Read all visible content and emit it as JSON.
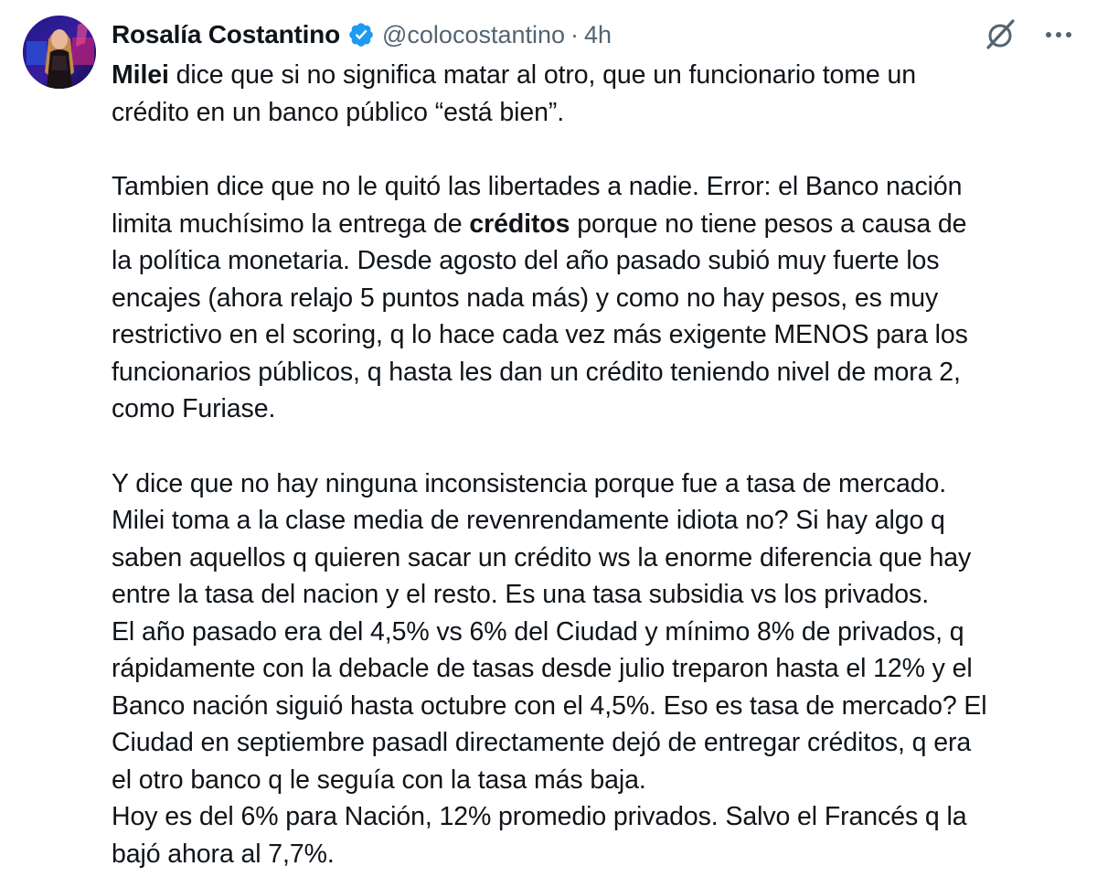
{
  "author": {
    "name": "Rosalía Costantino",
    "handle": "@colocostantino",
    "separator": "·",
    "time": "4h"
  },
  "colors": {
    "text": "#0f1419",
    "secondary": "#536471",
    "verified": "#1d9bf0"
  },
  "icons": {
    "verified": "verified-badge-icon",
    "grok": "grok-icon",
    "more": "more-horizontal-icon"
  },
  "tweet": {
    "p1": {
      "bold": "Milei",
      "l1_rest": " dice que si no significa matar al otro, que un funcionario tome un",
      "l2": "crédito en un banco público “está bien”."
    },
    "p2": {
      "l1": "Tambien dice que no le quitó las libertades a nadie. Error: el Banco nación",
      "l2_pre": "limita muchísimo la entrega de ",
      "l2_bold": "créditos",
      "l2_post": " porque no tiene pesos a causa de",
      "l3": "la política monetaria. Desde agosto del año pasado subió muy fuerte los",
      "l4": "encajes (ahora relajo 5 puntos nada más) y como no hay pesos, es muy",
      "l5": "restrictivo en el scoring, q lo hace cada vez más exigente MENOS para los",
      "l6": "funcionarios públicos, q hasta les dan un crédito teniendo nivel de mora 2,",
      "l7": "como Furiase."
    },
    "p3": {
      "l1": "Y dice que no hay ninguna inconsistencia porque fue a tasa de mercado.",
      "l2": "Milei toma a la clase media de revenrendamente idiota no? Si hay algo q",
      "l3": "saben aquellos q quieren sacar un crédito ws la enorme diferencia que hay",
      "l4": "entre la tasa del nacion y el resto. Es una tasa subsidia vs los privados.",
      "l5": "El año pasado era del 4,5% vs 6% del Ciudad y mínimo 8% de privados, q",
      "l6": "rápidamente con la debacle de tasas desde julio treparon hasta el 12% y el",
      "l7": "Banco nación siguió hasta octubre con el 4,5%. Eso es tasa de mercado? El",
      "l8": "Ciudad en septiembre pasadl directamente dejó de entregar créditos, q era",
      "l9": "el otro banco q le seguía con la tasa más baja.",
      "l10": "Hoy es del 6% para Nación, 12% promedio privados. Salvo el Francés q la",
      "l11": "bajó ahora al 7,7%."
    }
  }
}
